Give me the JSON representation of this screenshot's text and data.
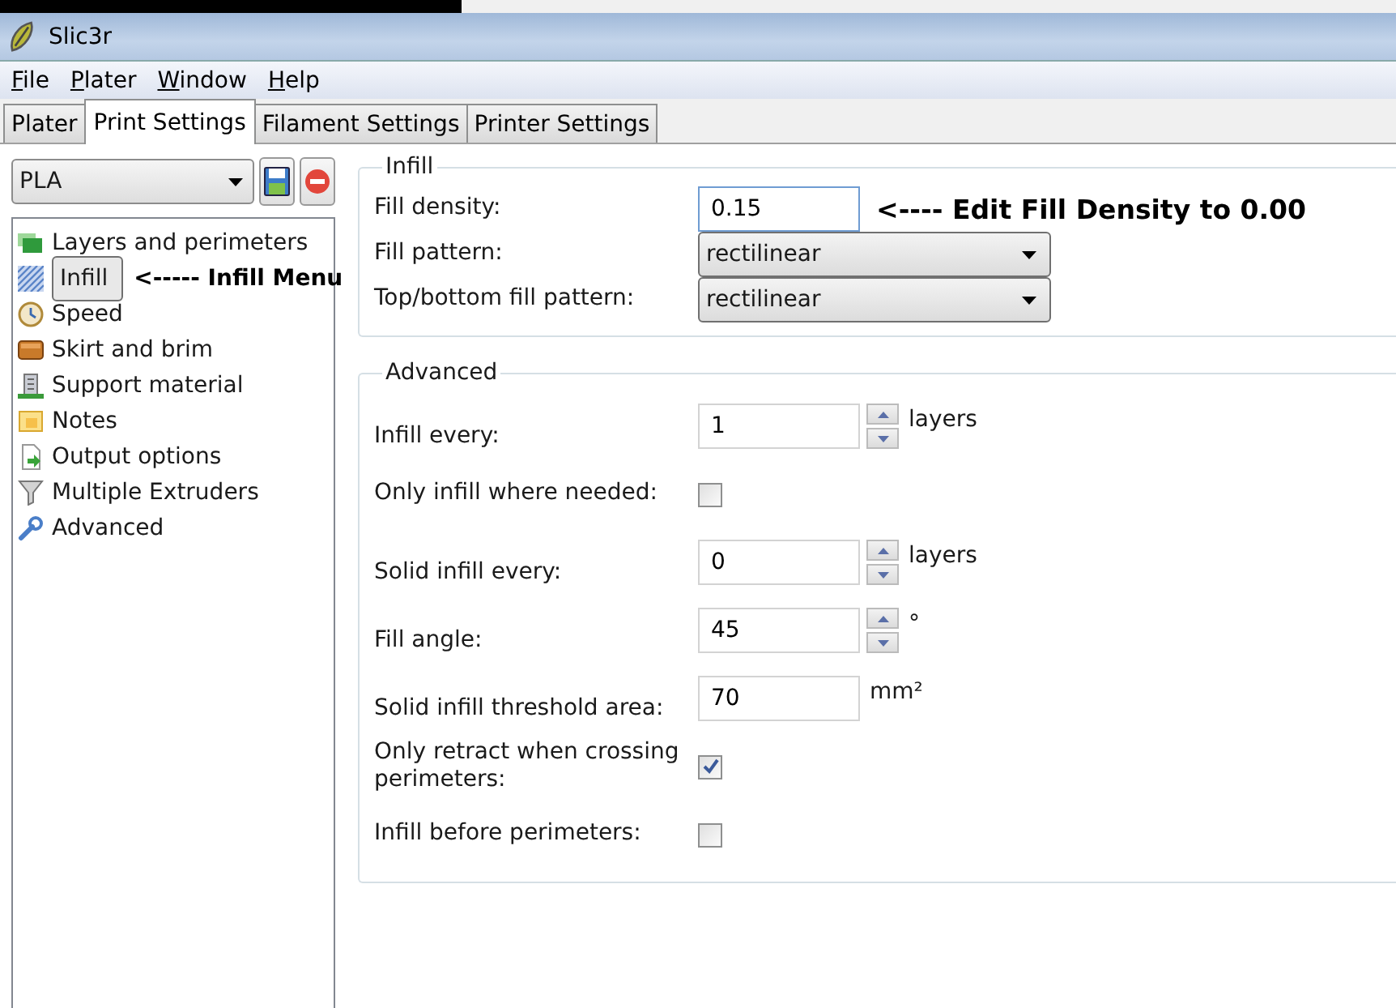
{
  "window": {
    "title": "Slic3r"
  },
  "menu": [
    "File",
    "Plater",
    "Window",
    "Help"
  ],
  "tabs": [
    {
      "label": "Plater",
      "selected": false
    },
    {
      "label": "Print Settings",
      "selected": true
    },
    {
      "label": "Filament Settings",
      "selected": false
    },
    {
      "label": "Printer Settings",
      "selected": false
    }
  ],
  "preset": {
    "value": "PLA"
  },
  "categories": [
    {
      "kind": "layers",
      "label": "Layers and perimeters",
      "selected": false
    },
    {
      "kind": "infill",
      "label": "Infill",
      "selected": true,
      "annotation": "<----- Infill Menu"
    },
    {
      "kind": "speed",
      "label": "Speed",
      "selected": false
    },
    {
      "kind": "skirt",
      "label": "Skirt and brim",
      "selected": false
    },
    {
      "kind": "support",
      "label": "Support material",
      "selected": false
    },
    {
      "kind": "notes",
      "label": "Notes",
      "selected": false
    },
    {
      "kind": "output",
      "label": "Output options",
      "selected": false
    },
    {
      "kind": "extruders",
      "label": "Multiple Extruders",
      "selected": false
    },
    {
      "kind": "advanced",
      "label": "Advanced",
      "selected": false
    }
  ],
  "groups": [
    {
      "title": "Infill",
      "rows": [
        {
          "kind": "input",
          "label": "Fill density:",
          "value": "0.15",
          "focused": true,
          "spinner": false,
          "annotation": "<---- Edit Fill Density to 0.00"
        },
        {
          "kind": "select",
          "label": "Fill pattern:",
          "value": "rectilinear"
        },
        {
          "kind": "select",
          "label": "Top/bottom fill pattern:",
          "value": "rectilinear"
        }
      ]
    },
    {
      "title": "Advanced",
      "rows": [
        {
          "kind": "input",
          "label": "Infill every:",
          "value": "1",
          "focused": false,
          "spinner": true,
          "unit": "layers"
        },
        {
          "kind": "checkbox",
          "label": "Only infill where needed:",
          "checked": false
        },
        {
          "kind": "input",
          "label": "Solid infill every:",
          "value": "0",
          "focused": false,
          "spinner": true,
          "unit": "layers"
        },
        {
          "kind": "input",
          "label": "Fill angle:",
          "value": "45",
          "focused": false,
          "spinner": true,
          "unit": "°"
        },
        {
          "kind": "input",
          "label": "Solid infill threshold area:",
          "value": "70",
          "focused": false,
          "spinner": false,
          "unit": "mm²"
        },
        {
          "kind": "checkbox",
          "label": "Only retract when crossing perimeters:",
          "checked": true
        },
        {
          "kind": "checkbox",
          "label": "Infill before perimeters:",
          "checked": false
        }
      ]
    }
  ]
}
